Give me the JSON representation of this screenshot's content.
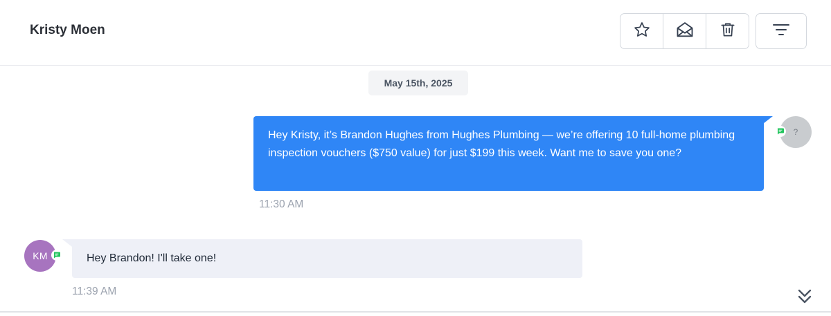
{
  "header": {
    "contact_name": "Kristy Moen",
    "actions": [
      {
        "name": "star",
        "icon": "star-icon"
      },
      {
        "name": "mark-read",
        "icon": "envelope-open-icon"
      },
      {
        "name": "delete",
        "icon": "trash-icon"
      }
    ],
    "filter_icon": "filter-lines-icon"
  },
  "thread": {
    "date_label": "May 15th, 2025",
    "messages": [
      {
        "direction": "outgoing",
        "text": "Hey Kristy, it’s Brandon Hughes from Hughes Plumbing — we’re offering 10 full-home plumbing inspection vouchers ($750 value) for just $199 this week. Want me to save you one?",
        "time": "11:30 AM",
        "avatar_text": "?",
        "channel_icon": "sms-chat-icon"
      },
      {
        "direction": "incoming",
        "text": "Hey Brandon! I'll take one!",
        "time": "11:39 AM",
        "avatar_text": "KM",
        "channel_icon": "sms-chat-icon"
      }
    ]
  },
  "scroll_icon": "double-chevron-down-icon",
  "colors": {
    "outgoing_bubble": "#2f86f6",
    "incoming_bubble": "#eef0f7",
    "avatar_km": "#a774bf",
    "channel_badge": "#22c55e"
  }
}
